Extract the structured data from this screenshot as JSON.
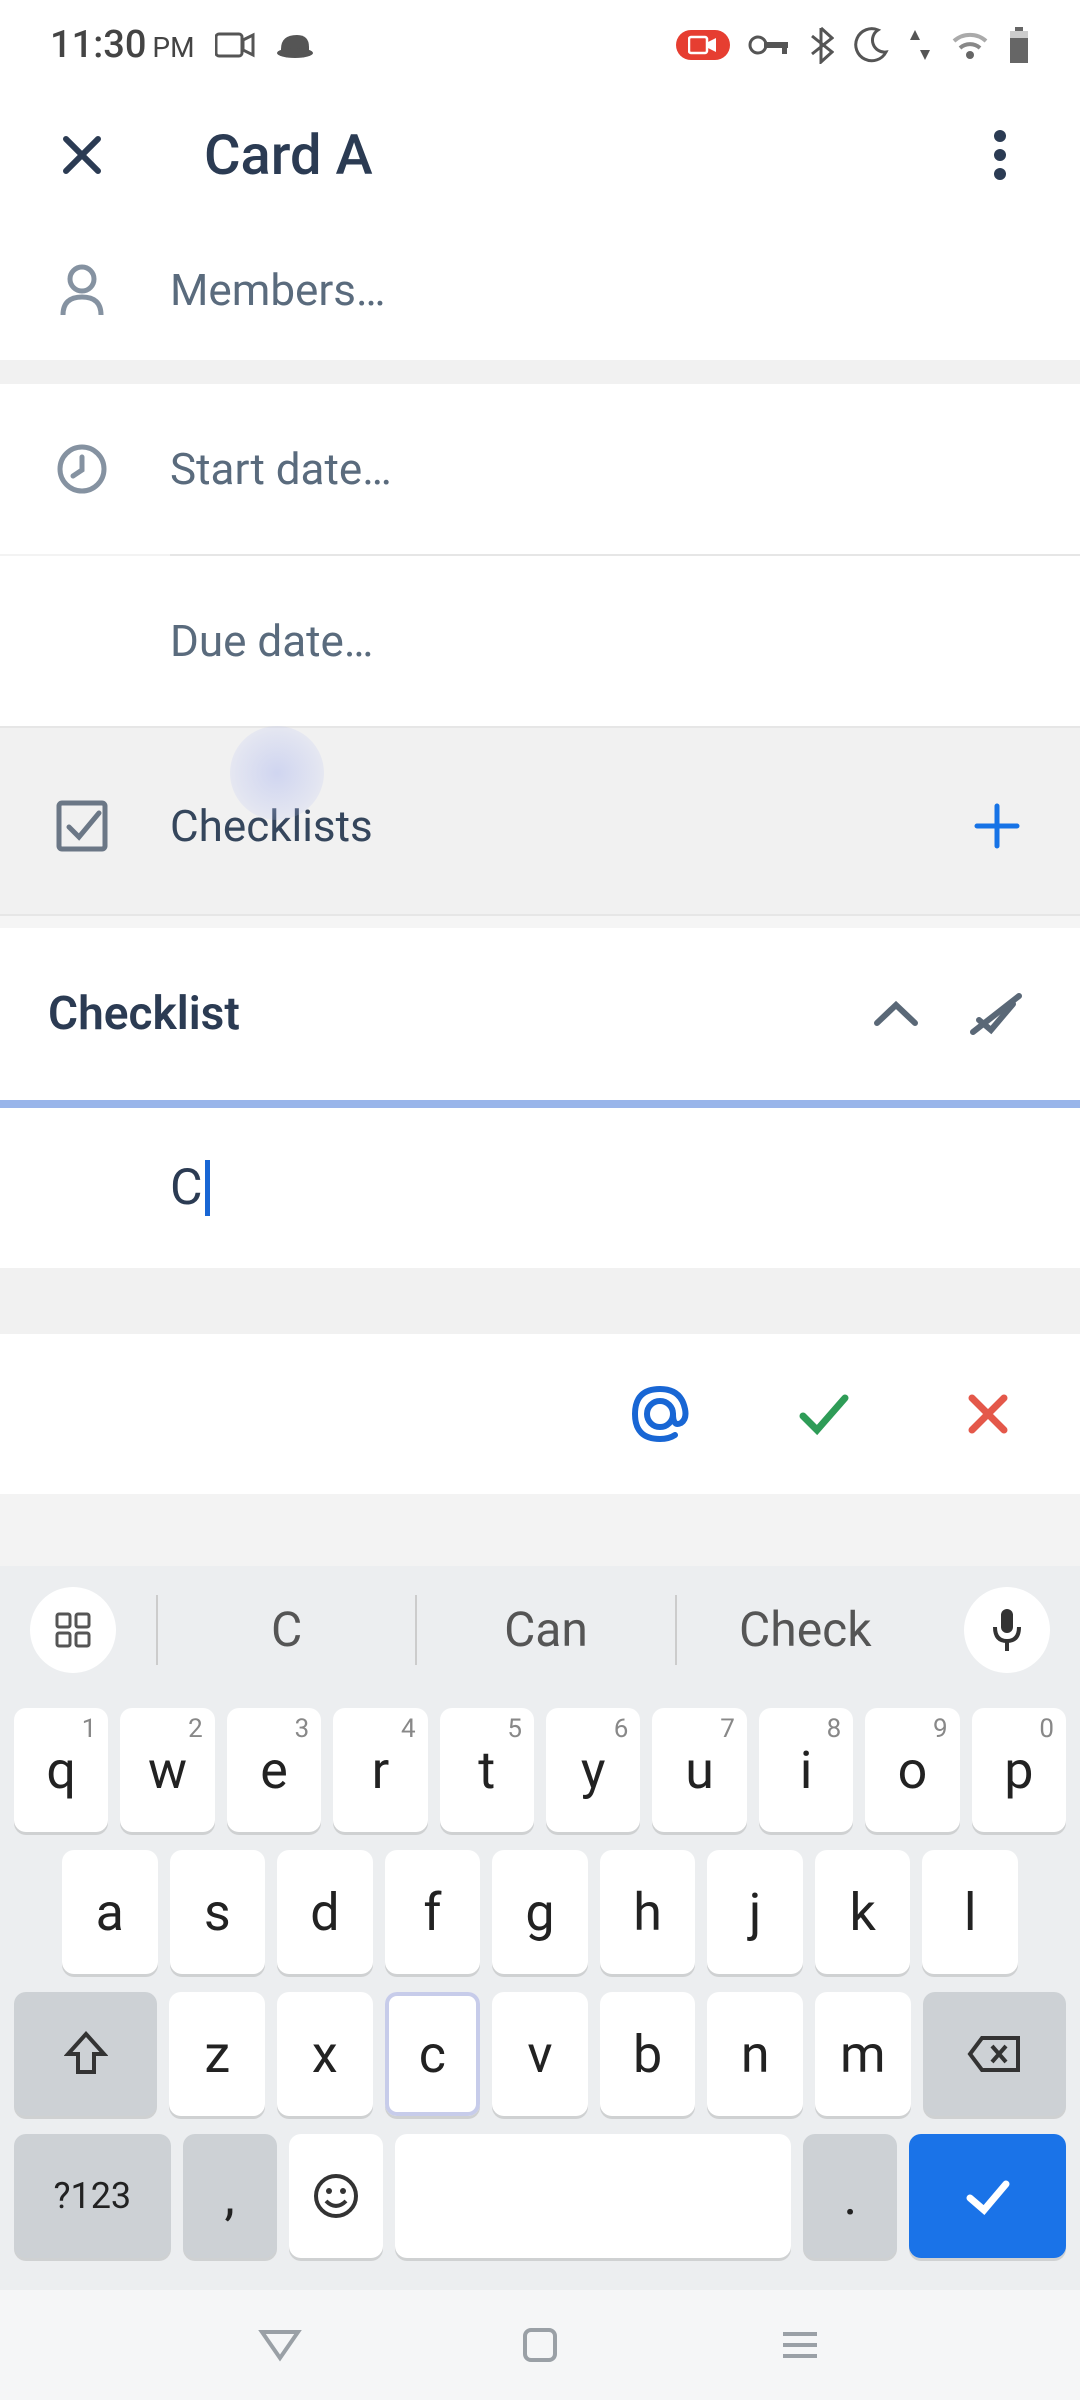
{
  "status": {
    "time": "11:30",
    "ampm": "PM"
  },
  "header": {
    "title": "Card A"
  },
  "rows": {
    "members": "Members…",
    "start_date": "Start date…",
    "due_date": "Due date…",
    "checklists": "Checklists"
  },
  "checklist": {
    "name": "Checklist",
    "input_value": "C"
  },
  "keyboard": {
    "suggestions": [
      "C",
      "Can",
      "Check"
    ],
    "row1": [
      {
        "k": "q",
        "n": "1"
      },
      {
        "k": "w",
        "n": "2"
      },
      {
        "k": "e",
        "n": "3"
      },
      {
        "k": "r",
        "n": "4"
      },
      {
        "k": "t",
        "n": "5"
      },
      {
        "k": "y",
        "n": "6"
      },
      {
        "k": "u",
        "n": "7"
      },
      {
        "k": "i",
        "n": "8"
      },
      {
        "k": "o",
        "n": "9"
      },
      {
        "k": "p",
        "n": "0"
      }
    ],
    "row2": [
      "a",
      "s",
      "d",
      "f",
      "g",
      "h",
      "j",
      "k",
      "l"
    ],
    "row3": [
      "z",
      "x",
      "c",
      "v",
      "b",
      "n",
      "m"
    ],
    "symbols_key": "?123",
    "comma": ",",
    "period": "."
  }
}
